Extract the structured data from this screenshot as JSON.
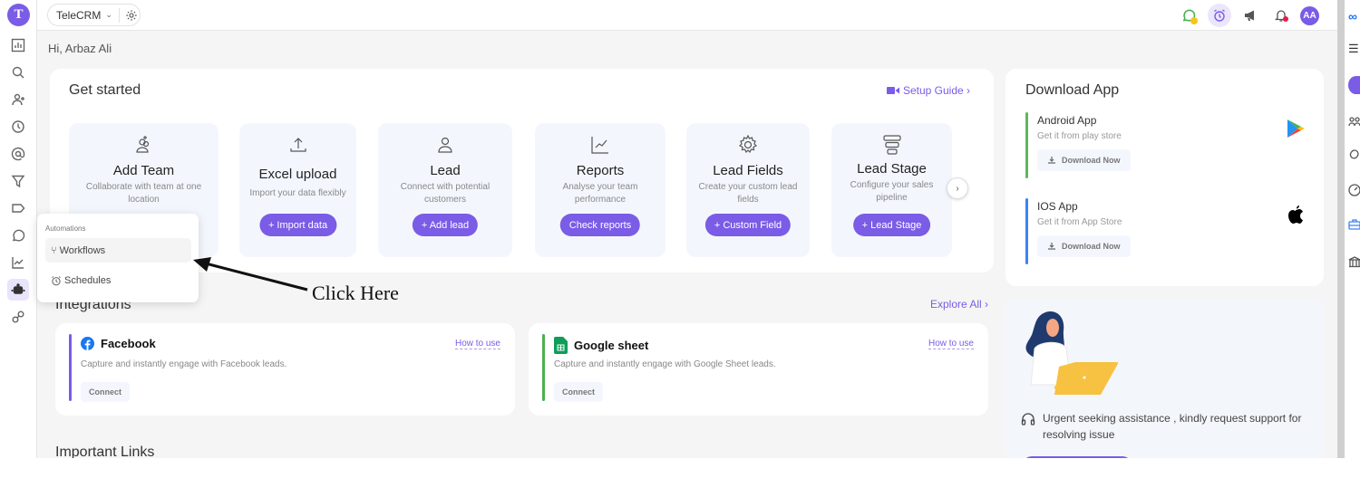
{
  "topbar": {
    "workspace": "TeleCRM",
    "avatar_initials": "AA"
  },
  "greeting": "Hi, Arbaz Ali",
  "get_started": {
    "title": "Get started",
    "setup_guide": "Setup Guide ›",
    "tiles": [
      {
        "title": "Add Team",
        "desc": "Collaborate with team at one location",
        "button": "",
        "icon": "add-team-icon"
      },
      {
        "title": "Excel upload",
        "desc": "Import your data flexibly",
        "button": "+ Import data",
        "icon": "upload-icon"
      },
      {
        "title": "Lead",
        "desc": "Connect with potential customers",
        "button": "+ Add lead",
        "icon": "user-icon"
      },
      {
        "title": "Reports",
        "desc": "Analyse your team performance",
        "button": "Check reports",
        "icon": "line-chart-icon"
      },
      {
        "title": "Lead Fields",
        "desc": "Create your custom lead fields",
        "button": "+ Custom Field",
        "icon": "gear-icon"
      },
      {
        "title": "Lead Stage",
        "desc": "Configure your sales pipeline",
        "button": "+ Lead Stage",
        "icon": "funnel-stack-icon"
      }
    ]
  },
  "download_app": {
    "title": "Download App",
    "apps": [
      {
        "name": "Android App",
        "subtitle": "Get it from play store",
        "button": "Download Now",
        "accent": "#5cb85c"
      },
      {
        "name": "IOS App",
        "subtitle": "Get it from App Store",
        "button": "Download Now",
        "accent": "#3b82f6"
      }
    ]
  },
  "integrations": {
    "title": "Integrations",
    "explore_all": "Explore All ›",
    "items": [
      {
        "name": "Facebook",
        "desc": "Capture and instantly engage with Facebook leads.",
        "how_to": "How to use",
        "button": "Connect",
        "accent": "#7a5ce6"
      },
      {
        "name": "Google sheet",
        "desc": "Capture and instantly engage with Google Sheet leads.",
        "how_to": "How to use",
        "button": "Connect",
        "accent": "#4caf50"
      }
    ]
  },
  "support": {
    "text": "Urgent seeking assistance , kindly request support for resolving issue"
  },
  "important_links": "Important Links",
  "automations_menu": {
    "header": "Automations",
    "items": [
      {
        "label": "Workflows",
        "selected": true
      },
      {
        "label": "Schedules",
        "selected": false
      }
    ]
  },
  "annotation": "Click Here",
  "colors": {
    "accent": "#7a5ce6"
  }
}
